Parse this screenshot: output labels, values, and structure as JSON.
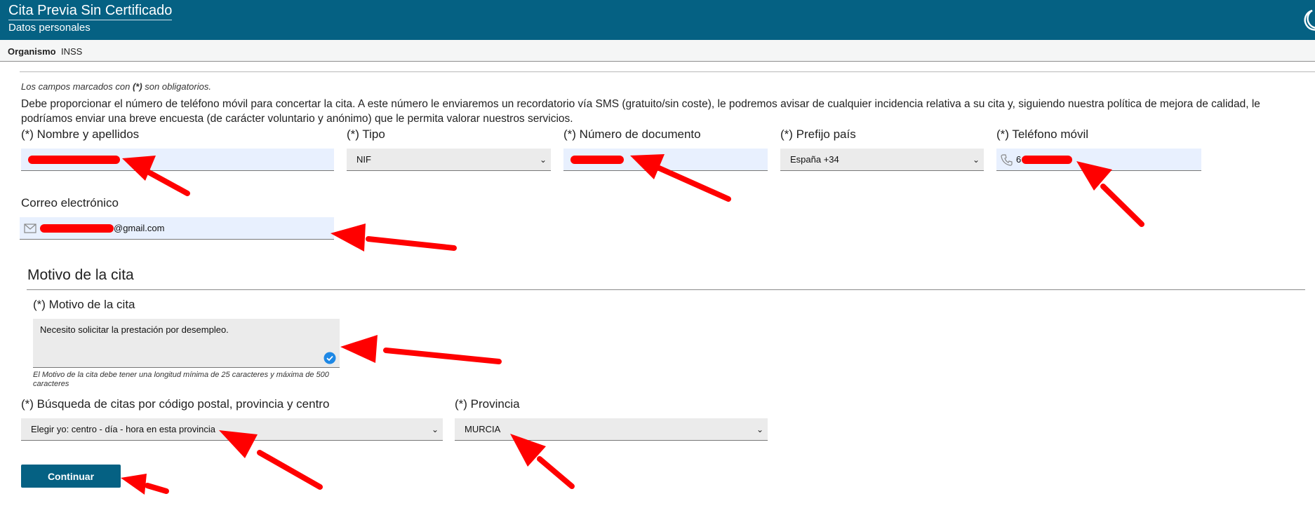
{
  "header": {
    "title": "Cita Previa Sin Certificado",
    "subtitle": "Datos personales"
  },
  "organismo": {
    "label": "Organismo",
    "value": "INSS"
  },
  "form": {
    "required_note": "Los campos marcados con (*) son obligatorios.",
    "info_text": "Debe proporcionar el número de teléfono móvil para concertar la cita. A este número le enviaremos un recordatorio vía SMS (gratuito/sin coste), le podremos avisar de cualquier incidencia relativa a su cita y, siguiendo nuestra política de mejora de calidad, le podríamos enviar una breve encuesta (de carácter voluntario y anónimo) que le permita valorar nuestros servicios.",
    "nombre": {
      "label": "(*) Nombre y apellidos",
      "value": ""
    },
    "tipo": {
      "label": "(*) Tipo",
      "value": "NIF"
    },
    "documento": {
      "label": "(*) Número de documento",
      "value": ""
    },
    "prefijo": {
      "label": "(*) Prefijo país",
      "value": "España +34"
    },
    "telefono": {
      "label": "(*) Teléfono móvil",
      "value_prefix": "6"
    },
    "email": {
      "label": "Correo electrónico",
      "value_suffix": "@gmail.com"
    }
  },
  "motivo": {
    "section_title": "Motivo de la cita",
    "label": "(*) Motivo de la cita",
    "value": "Necesito solicitar la prestación por desempleo.",
    "hint": "El Motivo de la cita debe tener una longitud mínima de 25 caracteres y máxima de 500 caracteres"
  },
  "busqueda": {
    "label": "(*) Búsqueda de citas por código postal, provincia y centro",
    "value": "Elegir yo: centro - día - hora en esta provincia"
  },
  "provincia": {
    "label": "(*) Provincia",
    "value": "MURCIA"
  },
  "continue_button": "Continuar",
  "colors": {
    "header_bg": "#056183",
    "field_bg": "#e8f0fe",
    "select_bg": "#ebebeb",
    "annotation_red": "#ff0000",
    "check_blue": "#1e88e5"
  }
}
